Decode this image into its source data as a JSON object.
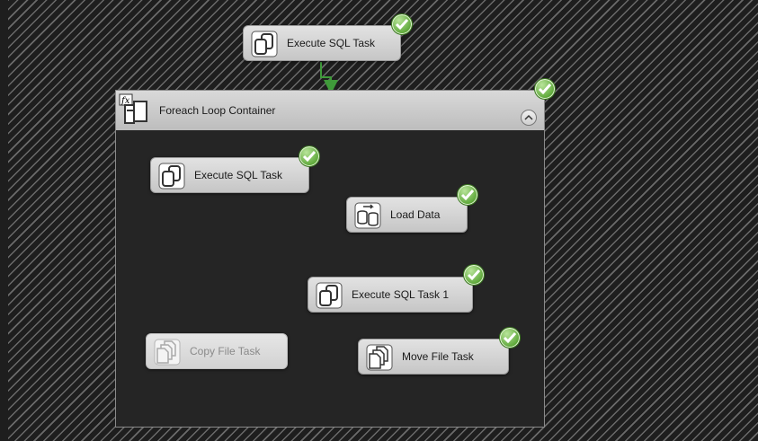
{
  "package": {
    "top_task": {
      "label": "Execute SQL Task",
      "status": "success",
      "icon": "execute-sql-icon"
    },
    "container": {
      "title": "Foreach Loop Container",
      "status": "success",
      "icon": "foreach-loop-icon",
      "collapse_icon": "chevron-up-icon",
      "tasks": [
        {
          "id": "exec-sql",
          "label": "Execute SQL Task",
          "status": "success",
          "icon": "execute-sql-icon"
        },
        {
          "id": "load-data",
          "label": "Load Data",
          "status": "success",
          "icon": "data-flow-icon"
        },
        {
          "id": "exec-sql-1",
          "label": "Execute SQL Task 1",
          "status": "success",
          "icon": "execute-sql-icon"
        },
        {
          "id": "copy-file",
          "label": "Copy File Task",
          "status": "disabled",
          "icon": "file-system-icon"
        },
        {
          "id": "move-file",
          "label": "Move File Task",
          "status": "success",
          "icon": "file-system-icon"
        }
      ]
    }
  },
  "colors": {
    "connector": "#3f9a3a",
    "success": "#5ea83a",
    "canvas": "#1e1e1e"
  }
}
